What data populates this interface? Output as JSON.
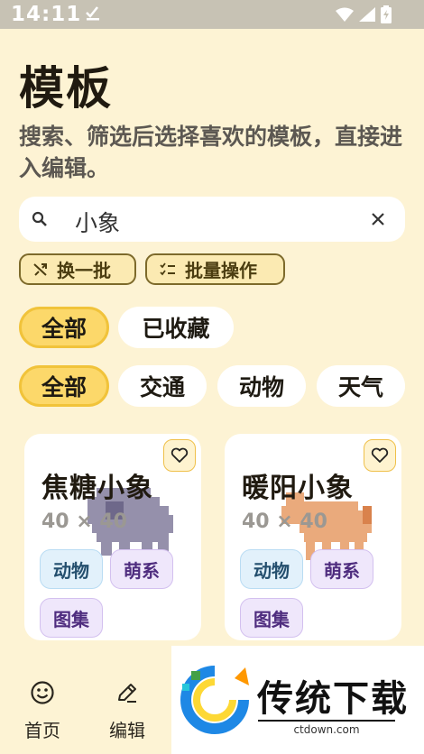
{
  "status_bar": {
    "time": "14:11"
  },
  "header": {
    "title": "模板",
    "subtitle": "搜索、筛选后选择喜欢的模板，直接进入编辑。"
  },
  "search": {
    "value": "小象",
    "icon": "search-icon",
    "clear_icon": "close-icon"
  },
  "actions": {
    "shuffle_label": "换一批",
    "batch_label": "批量操作"
  },
  "scope_tabs": [
    {
      "label": "全部",
      "selected": true
    },
    {
      "label": "已收藏",
      "selected": false
    }
  ],
  "category_chips": [
    {
      "label": "全部",
      "selected": true
    },
    {
      "label": "交通",
      "selected": false
    },
    {
      "label": "动物",
      "selected": false
    },
    {
      "label": "天气",
      "selected": false
    }
  ],
  "templates": [
    {
      "title": "焦糖小象",
      "size": "40 × 40",
      "tags": [
        "动物",
        "萌系",
        "图集"
      ],
      "art_color": "#8a84a3"
    },
    {
      "title": "暖阳小象",
      "size": "40 × 40",
      "tags": [
        "动物",
        "萌系",
        "图集"
      ],
      "art_color": "#e9a676"
    }
  ],
  "bottom_nav": [
    {
      "label": "首页",
      "icon": "smile-icon"
    },
    {
      "label": "编辑",
      "icon": "pencil-icon"
    }
  ],
  "watermark": {
    "brand": "传统下载",
    "url": "ctdown.com"
  },
  "colors": {
    "background": "#fdf3d4",
    "accent": "#fcd86a",
    "accent_border": "#f1c33a"
  }
}
